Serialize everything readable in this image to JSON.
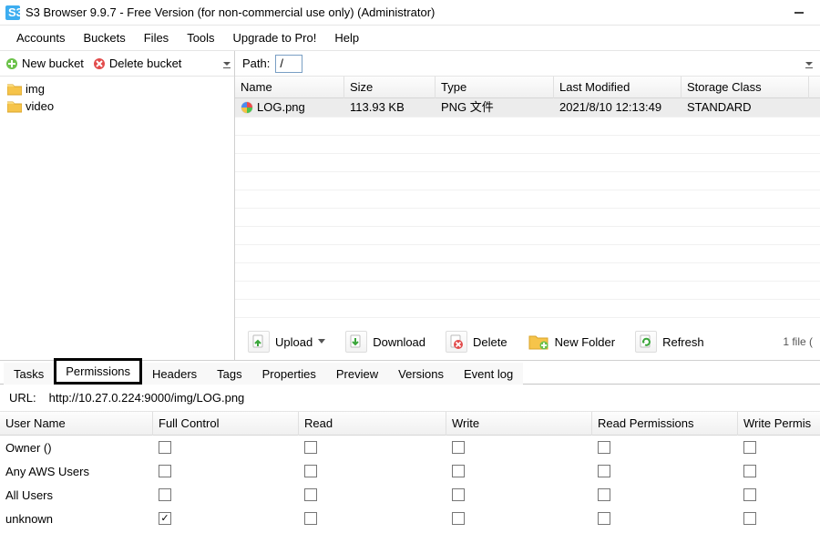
{
  "window": {
    "title": "S3 Browser 9.9.7 - Free Version (for non-commercial use only) (Administrator)"
  },
  "menu": {
    "accounts": "Accounts",
    "buckets": "Buckets",
    "files": "Files",
    "tools": "Tools",
    "upgrade": "Upgrade to Pro!",
    "help": "Help"
  },
  "bucket_toolbar": {
    "new": "New bucket",
    "delete": "Delete bucket"
  },
  "tree": {
    "items": [
      {
        "label": "img"
      },
      {
        "label": "video"
      }
    ]
  },
  "path": {
    "label": "Path:",
    "value": "/"
  },
  "file_table": {
    "headers": {
      "name": "Name",
      "size": "Size",
      "type": "Type",
      "last_modified": "Last Modified",
      "storage_class": "Storage Class"
    },
    "rows": [
      {
        "name": "LOG.png",
        "size": "113.93 KB",
        "type": "PNG 文件",
        "last_modified": "2021/8/10 12:13:49",
        "storage_class": "STANDARD"
      }
    ]
  },
  "actions": {
    "upload": "Upload",
    "download": "Download",
    "delete": "Delete",
    "new_folder": "New Folder",
    "refresh": "Refresh",
    "file_count": "1 file ("
  },
  "tabs": {
    "tasks": "Tasks",
    "permissions": "Permissions",
    "headers": "Headers",
    "tags": "Tags",
    "properties": "Properties",
    "preview": "Preview",
    "versions": "Versions",
    "event_log": "Event log"
  },
  "url": {
    "label": "URL:",
    "value": "http://10.27.0.224:9000/img/LOG.png"
  },
  "perm": {
    "headers": {
      "user": "User Name",
      "full": "Full Control",
      "read": "Read",
      "write": "Write",
      "read_perm": "Read Permissions",
      "write_perm": "Write Permis"
    },
    "rows": [
      {
        "name": "Owner ()",
        "full": false,
        "read": false,
        "write": false,
        "rp": false,
        "wp": false
      },
      {
        "name": "Any AWS Users",
        "full": false,
        "read": false,
        "write": false,
        "rp": false,
        "wp": false
      },
      {
        "name": "All Users",
        "full": false,
        "read": false,
        "write": false,
        "rp": false,
        "wp": false
      },
      {
        "name": "unknown",
        "full": true,
        "read": false,
        "write": false,
        "rp": false,
        "wp": false
      }
    ]
  }
}
